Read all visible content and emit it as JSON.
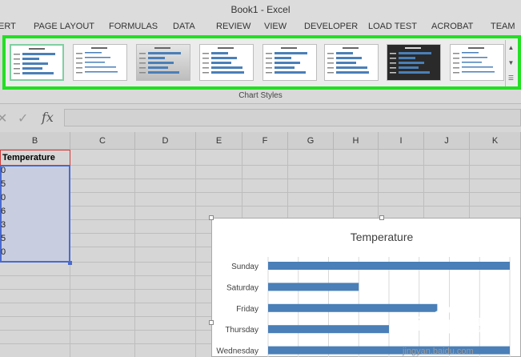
{
  "window": {
    "title": "Book1 - Excel"
  },
  "tabs": [
    "ERT",
    "PAGE LAYOUT",
    "FORMULAS",
    "DATA",
    "REVIEW",
    "VIEW",
    "DEVELOPER",
    "LOAD TEST",
    "ACROBAT",
    "TEAM"
  ],
  "ribbon": {
    "group_label": "Chart Styles",
    "style_count": 8,
    "selected_index": 0
  },
  "formula_bar": {
    "cancel_glyph": "✕",
    "enter_glyph": "✓",
    "fx_label": "fx",
    "value": ""
  },
  "columns": [
    "B",
    "C",
    "D",
    "E",
    "F",
    "G",
    "H",
    "I",
    "J",
    "K"
  ],
  "column_b": {
    "header": "Temperature",
    "cells": [
      "0",
      "5",
      "0",
      "6",
      "3",
      "5",
      "0"
    ]
  },
  "chart_data": {
    "type": "bar",
    "title": "Temperature",
    "categories": [
      "Sunday",
      "Saturday",
      "Friday",
      "Thursday",
      "Wednesday"
    ],
    "values": [
      80,
      30,
      56,
      40,
      80
    ],
    "xlim": [
      0,
      80
    ],
    "grid": true,
    "bar_color": "#4a7fb8"
  },
  "colors": {
    "selection_border": "#22e022",
    "accent": "#4a7fb8"
  },
  "watermark": {
    "brand": "Baidu",
    "brand_cn": "经验",
    "url": "jingyan.baidu.com"
  }
}
